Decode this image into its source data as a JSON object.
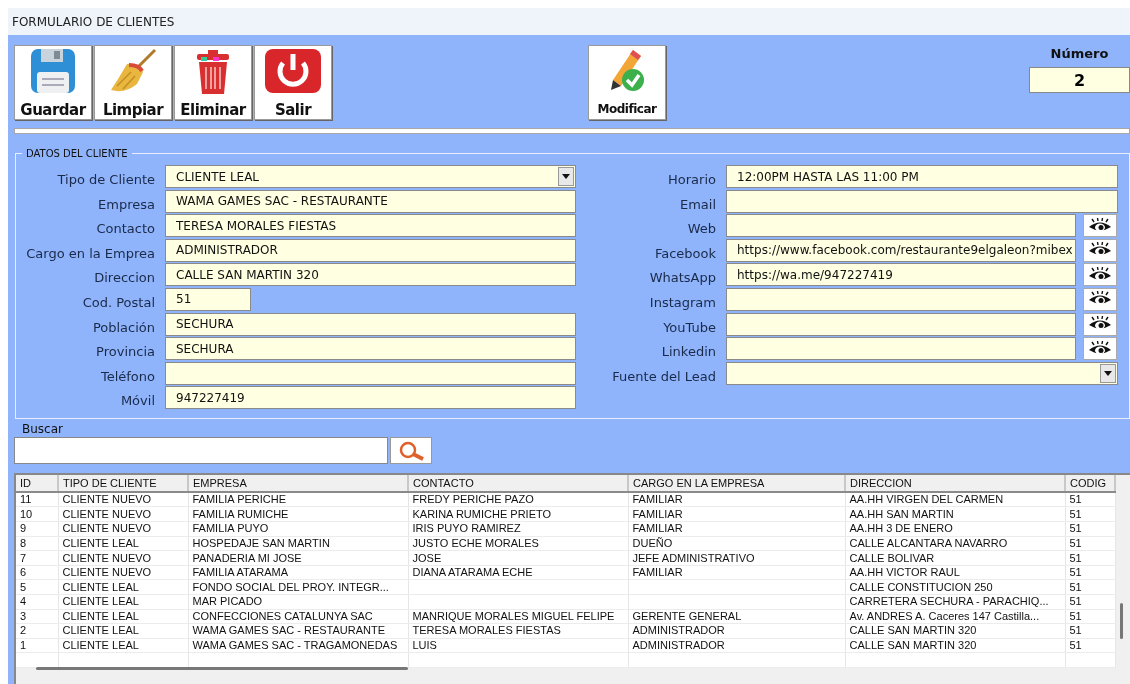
{
  "window": {
    "title": "FORMULARIO DE CLIENTES"
  },
  "toolbar": [
    {
      "label": "Guardar",
      "kind": "save"
    },
    {
      "label": "Limpiar",
      "kind": "clear"
    },
    {
      "label": "Eliminar",
      "kind": "delete"
    },
    {
      "label": "Salir",
      "kind": "exit"
    }
  ],
  "edit_button": {
    "label": "Modificar",
    "kind": "edit"
  },
  "numero": {
    "label": "Número",
    "value": "2"
  },
  "client_group": {
    "title": "DATOS DEL CLIENTE",
    "left_fields": [
      {
        "label": "Tipo de Cliente",
        "value": "CLIENTE LEAL",
        "kind": "combo"
      },
      {
        "label": "Empresa",
        "value": "WAMA GAMES SAC - RESTAURANTE",
        "kind": "text"
      },
      {
        "label": "Contacto",
        "value": "TERESA MORALES FIESTAS",
        "kind": "text"
      },
      {
        "label": "Cargo en la Emprea",
        "value": "ADMINISTRADOR",
        "kind": "text"
      },
      {
        "label": "Direccion",
        "value": "CALLE SAN MARTIN 320",
        "kind": "text"
      },
      {
        "label": "Cod. Postal",
        "value": "51",
        "kind": "short"
      },
      {
        "label": "Población",
        "value": "SECHURA",
        "kind": "text"
      },
      {
        "label": "Provincia",
        "value": "SECHURA",
        "kind": "text"
      },
      {
        "label": "Teléfono",
        "kind": "text"
      },
      {
        "label": "Móvil",
        "value": "947227419",
        "kind": "text"
      }
    ],
    "right_fields": [
      {
        "label": "Horario",
        "value": "12:00PM HASTA LAS 11:00 PM",
        "kind": "text"
      },
      {
        "label": "Email",
        "kind": "text"
      },
      {
        "label": "Web",
        "kind": "link"
      },
      {
        "label": "Facebook",
        "value": "https://www.facebook.com/restaurante9elgaleon?mibex",
        "kind": "link"
      },
      {
        "label": "WhatsApp",
        "value": "https://wa.me/947227419",
        "kind": "link"
      },
      {
        "label": "Instagram",
        "kind": "link"
      },
      {
        "label": "YouTube",
        "kind": "link"
      },
      {
        "label": "Linkedin",
        "kind": "link"
      },
      {
        "label": "Fuente del Lead",
        "kind": "combo"
      }
    ]
  },
  "search": {
    "label": "Buscar"
  },
  "table": {
    "columns": [
      "ID",
      "TIPO DE CLIENTE",
      "EMPRESA",
      "CONTACTO",
      "CARGO EN LA EMPRESA",
      "DIRECCION",
      "CODIG"
    ],
    "rows": [
      [
        "11",
        "CLIENTE NUEVO",
        "FAMILIA PERICHE",
        "FREDY PERICHE PAZO",
        "FAMILIAR",
        "AA.HH VIRGEN DEL CARMEN",
        "51"
      ],
      [
        "10",
        "CLIENTE NUEVO",
        "FAMILIA RUMICHE",
        "KARINA RUMICHE PRIETO",
        "FAMILIAR",
        "AA.HH SAN MARTIN",
        "51"
      ],
      [
        "9",
        "CLIENTE NUEVO",
        "FAMILIA PUYO",
        "IRIS PUYO RAMIREZ",
        "FAMILIAR",
        "AA.HH 3 DE ENERO",
        "51"
      ],
      [
        "8",
        "CLIENTE LEAL",
        "HOSPEDAJE SAN MARTIN",
        "JUSTO ECHE MORALES",
        "DUEÑO",
        "CALLE ALCANTARA NAVARRO",
        "51"
      ],
      [
        "7",
        "CLIENTE NUEVO",
        "PANADERIA MI JOSE",
        "JOSE",
        "JEFE ADMINISTRATIVO",
        "CALLE BOLIVAR",
        "51"
      ],
      [
        "6",
        "CLIENTE NUEVO",
        "FAMILIA ATARAMA",
        "DIANA ATARAMA ECHE",
        "FAMILIAR",
        "AA.HH VICTOR RAUL",
        "51"
      ],
      [
        "5",
        "CLIENTE LEAL",
        "FONDO SOCIAL DEL PROY. INTEGR...",
        null,
        null,
        "CALLE CONSTITUCION 250",
        "51"
      ],
      [
        "4",
        "CLIENTE LEAL",
        "MAR PICADO",
        null,
        null,
        "CARRETERA SECHURA - PARACHIQ...",
        "51"
      ],
      [
        "3",
        "CLIENTE LEAL",
        "CONFECCIONES CATALUNYA SAC",
        "MANRIQUE MORALES MIGUEL FELIPE",
        "GERENTE GENERAL",
        "Av. ANDRES A. Caceres 147 Castilla...",
        "51"
      ],
      [
        "2",
        "CLIENTE LEAL",
        "WAMA GAMES SAC - RESTAURANTE",
        "TERESA MORALES FIESTAS",
        "ADMINISTRADOR",
        "CALLE SAN MARTIN 320",
        "51"
      ],
      [
        "1",
        "CLIENTE LEAL",
        "WAMA GAMES SAC - TRAGAMONEDAS",
        "LUIS",
        "ADMINISTRADOR",
        "CALLE SAN MARTIN 320",
        "51"
      ]
    ]
  }
}
